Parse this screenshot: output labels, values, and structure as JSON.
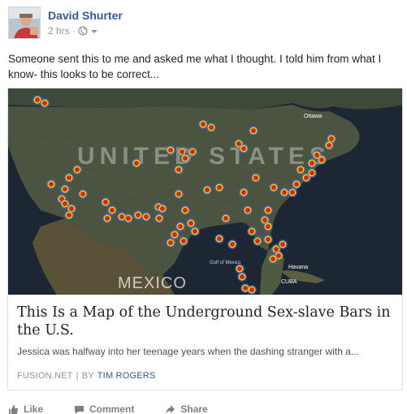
{
  "post": {
    "author": "David Shurter",
    "time": "2 hrs",
    "privacy_icon": "globe-icon",
    "text": "Someone sent this to me and asked me what I thought. I told him from what I know- this looks to be correct..."
  },
  "link_card": {
    "map_labels": {
      "country_us": "UNITED STATES",
      "country_mx": "MEXICO",
      "gulf": "Gulf of Mexico",
      "havana": "Havana",
      "cuba": "CUBA",
      "ottawa": "Ottawa"
    },
    "title": "This Is a Map of the Underground Sex-slave Bars in the U.S.",
    "description": "Jessica was halfway into her teenage years when the dashing stranger with a...",
    "source": "FUSION.NET",
    "separator": "|",
    "by_label": "BY",
    "author": "TIM ROGERS"
  },
  "actions": [
    {
      "label": "Like",
      "icon": "thumbs-up-icon"
    },
    {
      "label": "Comment",
      "icon": "comment-icon"
    },
    {
      "label": "Share",
      "icon": "share-icon"
    }
  ]
}
